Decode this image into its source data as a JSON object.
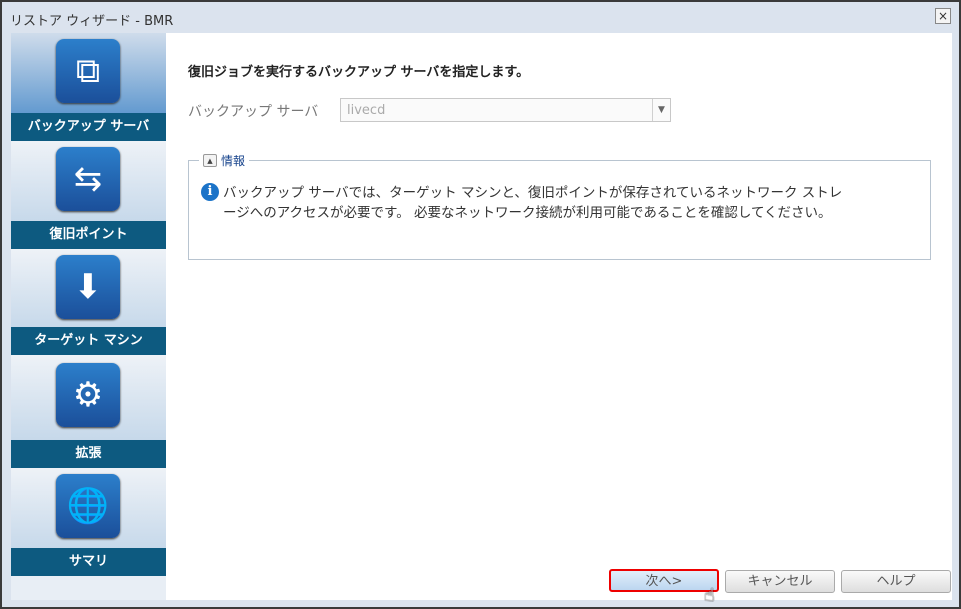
{
  "window": {
    "title": "リストア ウィザード - BMR",
    "close_icon": "×"
  },
  "sidebar": {
    "items": [
      {
        "label": "バックアップ サーバ",
        "icon": "⧉"
      },
      {
        "label": "復旧ポイント",
        "icon": "⇆"
      },
      {
        "label": "ターゲット マシン",
        "icon": "⬇"
      },
      {
        "label": "拡張",
        "icon": "⚙"
      },
      {
        "label": "サマリ",
        "icon": "🌐"
      }
    ]
  },
  "main": {
    "heading": "復旧ジョブを実行するバックアップ サーバを指定します。",
    "server_label": "バックアップ サーバ",
    "server_value": "livecd",
    "info_title": "情報",
    "info_text": "バックアップ サーバでは、ターゲット マシンと、復旧ポイントが保存されているネットワーク ストレージへのアクセスが必要です。 必要なネットワーク接続が利用可能であることを確認してください。"
  },
  "buttons": {
    "next": "次へ>",
    "cancel": "キャンセル",
    "help": "ヘルプ"
  }
}
